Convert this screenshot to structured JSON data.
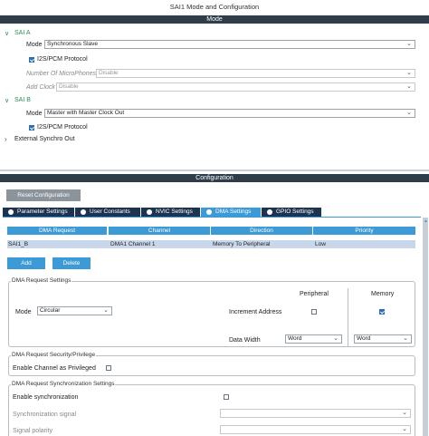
{
  "window_title": "SAI1 Mode and Configuration",
  "mode_bar": "Mode",
  "sai_a": {
    "label": "SAI A",
    "mode_label": "Mode",
    "mode_value": "Synchronous Slave",
    "protocol_label": "I2S/PCM Protocol",
    "mic_label": "Number Of MicroPhones",
    "mic_value": "Disable",
    "addclock_label": "Add Clock",
    "addclock_value": "Disable"
  },
  "sai_b": {
    "label": "SAI B",
    "mode_label": "Mode",
    "mode_value": "Master with Master Clock Out",
    "protocol_label": "I2S/PCM Protocol"
  },
  "external_synchro": "External Synchro Out",
  "config_bar": "Configuration",
  "reset_button": "Reset Configuration",
  "tabs": [
    {
      "label": "Parameter Settings"
    },
    {
      "label": "User Constants"
    },
    {
      "label": "NVIC Settings"
    },
    {
      "label": "DMA Settings"
    },
    {
      "label": "GPIO Settings"
    }
  ],
  "dma_table": {
    "headers": [
      "DMA Request",
      "Channel",
      "Direction",
      "Priority"
    ],
    "row": [
      "SAI1_B",
      "DMA1 Channel 1",
      "Memory To Peripheral",
      "Low"
    ]
  },
  "add_button": "Add",
  "delete_button": "Delete",
  "dma_request_settings": {
    "title": "DMA Request Settings",
    "peripheral_header": "Peripheral",
    "memory_header": "Memory",
    "mode_label": "Mode",
    "mode_value": "Circular",
    "increment_label": "Increment Address",
    "data_width_label": "Data Width",
    "peripheral_width": "Word",
    "memory_width": "Word"
  },
  "security": {
    "title": "DMA Request Security/Privilege",
    "privileged_label": "Enable Channel as Privileged"
  },
  "sync": {
    "title": "DMA Request Synchronization Settings",
    "enable_label": "Enable synchronization",
    "signal_label": "Synchronization signal",
    "polarity_label": "Signal polarity"
  },
  "colors": {
    "bar_dark": "#2f3d4a",
    "tab_dark": "#1e3350",
    "accent_blue": "#3c9ad6",
    "row_selected": "#c8d8ea",
    "tree_green": "#2e8b57"
  }
}
